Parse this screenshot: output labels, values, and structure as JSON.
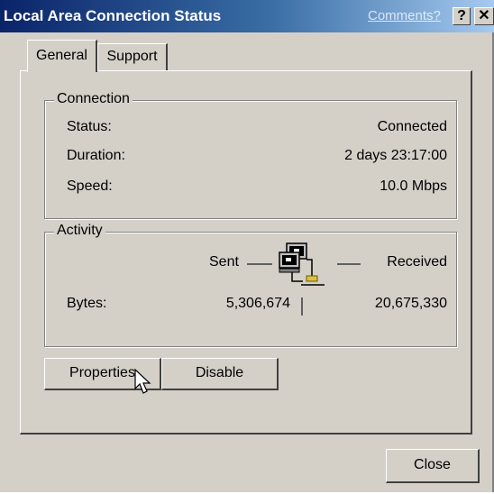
{
  "window": {
    "title": "Local Area Connection Status",
    "comments_link": "Comments?",
    "help_button": "?",
    "close_button": "✕"
  },
  "tabs": [
    {
      "label": "General",
      "active": true
    },
    {
      "label": "Support",
      "active": false
    }
  ],
  "connection": {
    "heading": "Connection",
    "rows": [
      {
        "label": "Status:",
        "value": "Connected"
      },
      {
        "label": "Duration:",
        "value": "2 days 23:17:00"
      },
      {
        "label": "Speed:",
        "value": "10.0 Mbps"
      }
    ]
  },
  "activity": {
    "heading": "Activity",
    "sent_label": "Sent",
    "received_label": "Received",
    "bytes_label": "Bytes:",
    "bytes_sent": "5,306,674",
    "bytes_received": "20,675,330",
    "icon": "network-computers-icon"
  },
  "buttons": {
    "properties": "Properties",
    "disable": "Disable",
    "close": "Close"
  }
}
